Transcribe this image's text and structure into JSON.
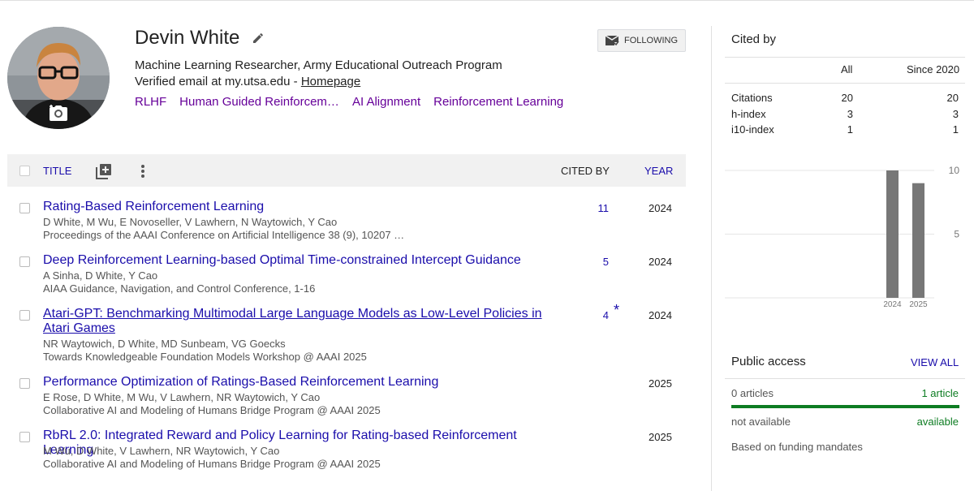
{
  "profile": {
    "name": "Devin White",
    "affiliation": "Machine Learning Researcher, Army Educational Outreach Program",
    "email_text": "Verified email at my.utsa.edu - ",
    "homepage_label": "Homepage",
    "follow_label": "FOLLOWING",
    "interests": [
      "RLHF",
      "Human Guided Reinforcem…",
      "AI Alignment",
      "Reinforcement Learning"
    ]
  },
  "table": {
    "headers": {
      "title": "TITLE",
      "cited_by": "CITED BY",
      "year": "YEAR"
    },
    "rows": [
      {
        "title": "Rating-Based Reinforcement Learning",
        "authors": "D White, M Wu, E Novoseller, V Lawhern, N Waytowich, Y Cao",
        "venue": "Proceedings of the AAAI Conference on Artificial Intelligence 38 (9), 10207 …",
        "cited_by": "11",
        "star": "",
        "year": "2024"
      },
      {
        "title": "Deep Reinforcement Learning-based Optimal Time-constrained Intercept Guidance",
        "authors": "A Sinha, D White, Y Cao",
        "venue": "AIAA Guidance, Navigation, and Control Conference, 1-16",
        "cited_by": "5",
        "star": "",
        "year": "2024"
      },
      {
        "title": "Atari-GPT: Benchmarking Multimodal Large Language Models as Low-Level Policies in Atari Games",
        "authors": "NR Waytowich, D White, MD Sunbeam, VG Goecks",
        "venue": "Towards Knowledgeable Foundation Models Workshop @ AAAI 2025",
        "cited_by": "4",
        "star": "*",
        "year": "2024"
      },
      {
        "title": "Performance Optimization of Ratings-Based Reinforcement Learning",
        "authors": "E Rose, D White, M Wu, V Lawhern, NR Waytowich, Y Cao",
        "venue": "Collaborative AI and Modeling of Humans Bridge Program @ AAAI 2025",
        "cited_by": "",
        "star": "",
        "year": "2025"
      },
      {
        "title": "RbRL 2.0: Integrated Reward and Policy Learning for Rating-based Reinforcement Learning",
        "authors": "M Wu, D White, V Lawhern, NR Waytowich, Y Cao",
        "venue": "Collaborative AI and Modeling of Humans Bridge Program @ AAAI 2025",
        "cited_by": "",
        "star": "",
        "year": "2025"
      }
    ]
  },
  "cited_by": {
    "title": "Cited by",
    "col_all": "All",
    "col_since": "Since 2020",
    "stats": [
      {
        "label": "Citations",
        "all": "20",
        "since": "20"
      },
      {
        "label": "h-index",
        "all": "3",
        "since": "3"
      },
      {
        "label": "i10-index",
        "all": "1",
        "since": "1"
      }
    ]
  },
  "chart_data": {
    "type": "bar",
    "categories": [
      "2024",
      "2025"
    ],
    "values": [
      10,
      9
    ],
    "yticks": [
      "10",
      "5"
    ],
    "ylim": [
      0,
      10
    ],
    "bar_color": "#777777"
  },
  "public_access": {
    "title": "Public access",
    "view_all": "VIEW ALL",
    "left_count": "0 articles",
    "right_count": "1 article",
    "left_status": "not available",
    "right_status": "available",
    "note": "Based on funding mandates",
    "available_color": "#0d7c22"
  }
}
